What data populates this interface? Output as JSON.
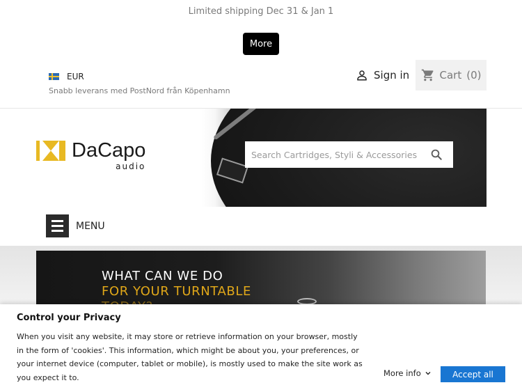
{
  "announcement": {
    "text": "Limited shipping Dec 31 & Jan 1",
    "more_label": "More"
  },
  "header": {
    "currency": "EUR",
    "delivery_note": "Snabb leverans med PostNord från Köpenhamn",
    "signin_label": "Sign in",
    "cart_label": "Cart",
    "cart_count": "(0)"
  },
  "brand": {
    "name": "DaCapo",
    "sub": "audio",
    "colors": {
      "accent": "#e8b923",
      "dark": "#1a1a1a"
    }
  },
  "search": {
    "placeholder": "Search Cartridges, Styli & Accessories",
    "icon": "search-icon"
  },
  "nav": {
    "menu_label": "MENU",
    "icon": "hamburger-icon"
  },
  "banner": {
    "line1": "WHAT CAN WE DO",
    "line2": "FOR YOUR TURNTABLE",
    "line3": "TODAY?",
    "colors": {
      "highlight": "#e0a719"
    }
  },
  "privacy": {
    "title": "Control your Privacy",
    "body": "When you visit any website, it may store or retrieve information on your browser, mostly in the form of 'cookies'. This information, which might be about you, your preferences, or your internet device (computer, tablet or mobile), is mostly used to make the site work as you expect it to.",
    "more_info_label": "More info",
    "accept_label": "Accept all",
    "colors": {
      "accept": "#1976d2"
    }
  }
}
